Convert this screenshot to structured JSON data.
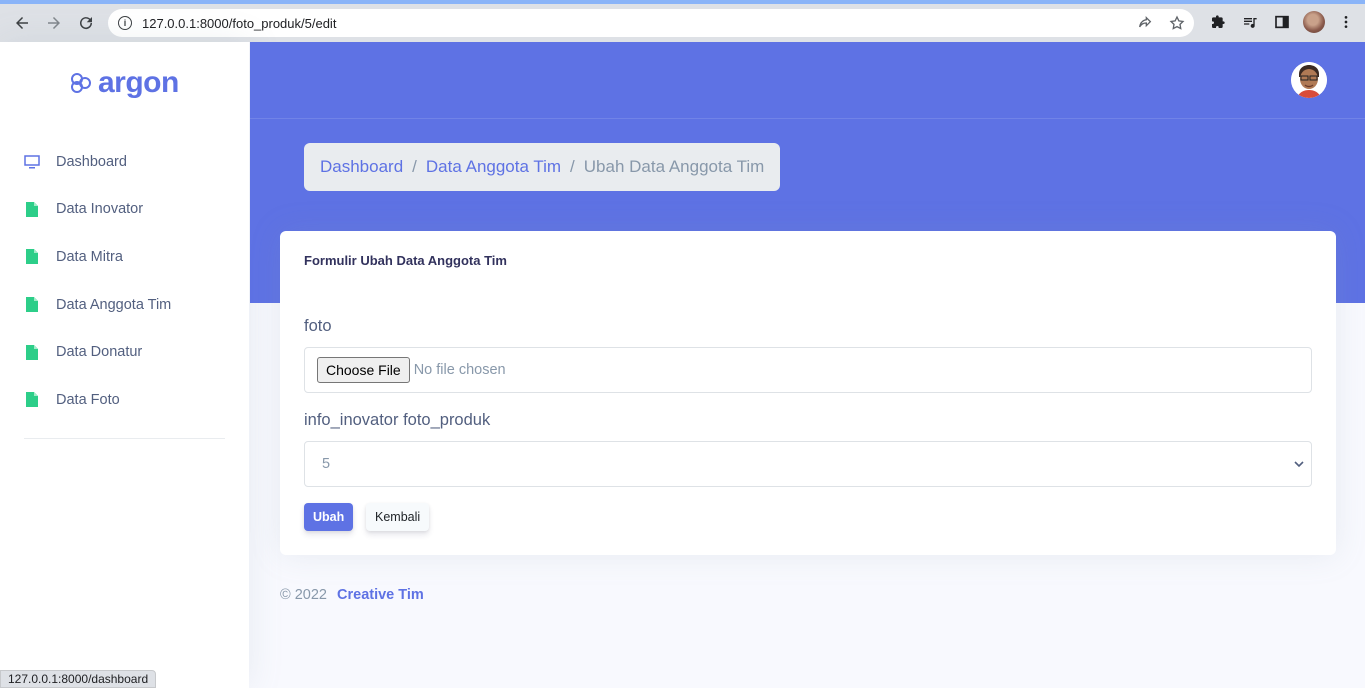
{
  "browser": {
    "url": "127.0.0.1:8000/foto_produk/5/edit",
    "status_url": "127.0.0.1:8000/dashboard"
  },
  "sidebar": {
    "brand": "argon",
    "items": [
      {
        "label": "Dashboard",
        "icon": "monitor-icon"
      },
      {
        "label": "Data Inovator",
        "icon": "file-icon"
      },
      {
        "label": "Data Mitra",
        "icon": "file-icon"
      },
      {
        "label": "Data Anggota Tim",
        "icon": "file-icon"
      },
      {
        "label": "Data Donatur",
        "icon": "file-icon"
      },
      {
        "label": "Data Foto",
        "icon": "file-icon"
      }
    ]
  },
  "breadcrumb": {
    "items": [
      "Dashboard",
      "Data Anggota Tim"
    ],
    "active": "Ubah Data Anggota Tim",
    "separator": "/"
  },
  "form": {
    "title": "Formulir Ubah Data Anggota Tim",
    "foto_label": "foto",
    "choose_file": "Choose File",
    "no_file": "No file chosen",
    "select_label": "info_inovator foto_produk",
    "select_value": "5",
    "submit_label": "Ubah",
    "back_label": "Kembali"
  },
  "footer": {
    "copyright": "© 2022",
    "brand": "Creative Tim"
  },
  "colors": {
    "primary": "#5e72e4",
    "success_icon": "#2dce89",
    "background": "#f8f9fe"
  }
}
